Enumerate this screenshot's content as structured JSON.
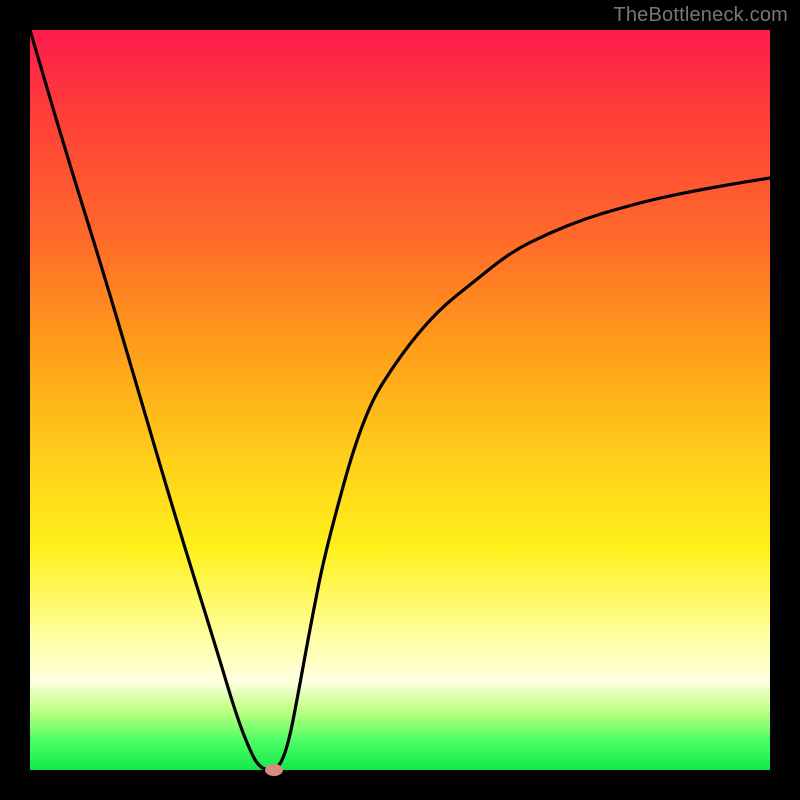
{
  "watermark": "TheBottleneck.com",
  "chart_data": {
    "type": "line",
    "title": "",
    "xlabel": "",
    "ylabel": "",
    "xlim": [
      0,
      100
    ],
    "ylim": [
      0,
      100
    ],
    "series": [
      {
        "name": "curve",
        "x": [
          0,
          5,
          10,
          15,
          20,
          25,
          28,
          30,
          31,
          32,
          33,
          34,
          35,
          36,
          38,
          40,
          45,
          50,
          55,
          60,
          65,
          70,
          75,
          80,
          85,
          90,
          95,
          100
        ],
        "values": [
          100,
          83,
          67,
          50,
          33,
          17,
          7,
          2,
          0.5,
          0,
          0,
          1,
          4,
          9,
          20,
          30,
          48,
          56,
          62,
          66,
          70,
          72.5,
          74.5,
          76,
          77.3,
          78.3,
          79.2,
          80
        ]
      }
    ],
    "marker": {
      "x": 33,
      "y": 0
    },
    "gradient_stops": [
      {
        "pct": 0,
        "color": "#ff1a4d"
      },
      {
        "pct": 10,
        "color": "#ff3a3a"
      },
      {
        "pct": 28,
        "color": "#ff6a2a"
      },
      {
        "pct": 42,
        "color": "#ff9a1a"
      },
      {
        "pct": 58,
        "color": "#ffcf1a"
      },
      {
        "pct": 70,
        "color": "#fff01a"
      },
      {
        "pct": 82,
        "color": "#ffffa0"
      },
      {
        "pct": 88,
        "color": "#ffffe0"
      },
      {
        "pct": 92,
        "color": "#c0ff80"
      },
      {
        "pct": 96,
        "color": "#4dff66"
      },
      {
        "pct": 100,
        "color": "#12e84a"
      }
    ]
  }
}
